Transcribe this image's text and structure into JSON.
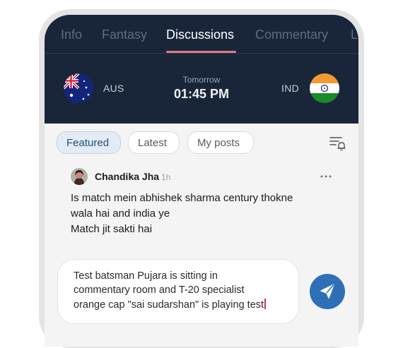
{
  "tabs": [
    {
      "label": "Info",
      "active": false
    },
    {
      "label": "Fantasy",
      "active": false
    },
    {
      "label": "Discussions",
      "active": true
    },
    {
      "label": "Commentary",
      "active": false
    },
    {
      "label": "L",
      "active": false
    }
  ],
  "match": {
    "home_team": "AUS",
    "away_team": "IND",
    "day": "Tomorrow",
    "time": "01:45 PM",
    "home_flag_icon": "australia-flag-icon",
    "away_flag_icon": "india-flag-icon"
  },
  "filters": {
    "chips": [
      {
        "label": "Featured",
        "active": true
      },
      {
        "label": "Latest",
        "active": false
      },
      {
        "label": "My posts",
        "active": false
      }
    ],
    "sort_icon": "filter-bell-icon"
  },
  "post": {
    "author": "Chandika Jha",
    "age": "1h",
    "more_icon": "more-options-icon",
    "lines": [
      "Is match mein abhishek sharma century thokne",
      "wala hai and india ye",
      "Match jit sakti hai"
    ]
  },
  "composer": {
    "lines": [
      "Test batsman Pujara is sitting in",
      "commentary room and T-20 specialist",
      "orange cap \"sai sudarshan\" is playing test"
    ],
    "send_icon": "send-icon"
  },
  "colors": {
    "header_bg": "#19263a",
    "accent_underline": "#e07a84",
    "chip_active_bg": "#e3ebf4",
    "chip_active_text": "#1d4f7f",
    "send_button": "#2f6fb6"
  }
}
